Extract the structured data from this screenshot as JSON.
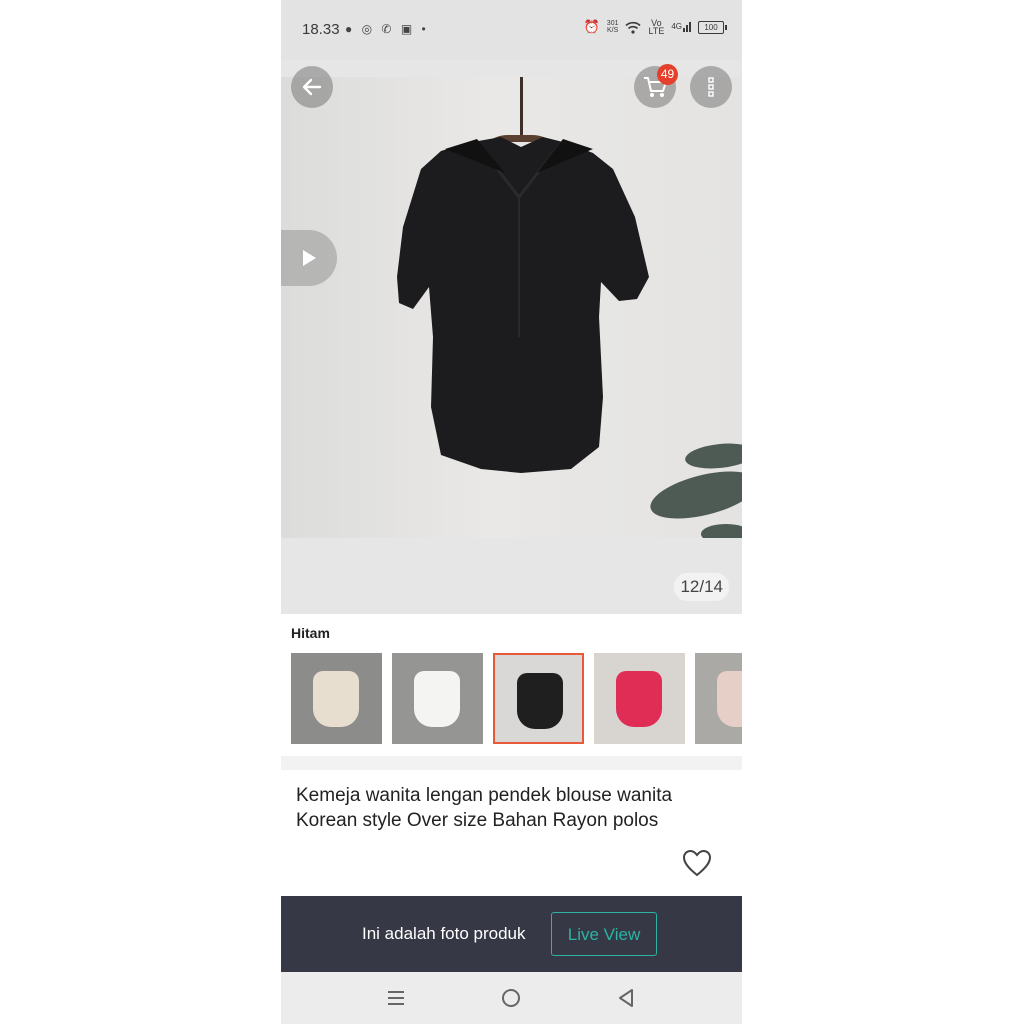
{
  "status_bar": {
    "time": "18.33",
    "left_icons": [
      "chat-icon",
      "whatsapp-icon",
      "call-icon",
      "instagram-icon",
      "dot-icon"
    ],
    "net_speed_top": "301",
    "net_speed_bottom": "K/S",
    "volte_top": "Vo",
    "volte_bottom": "LTE",
    "network": "4G",
    "battery": "100"
  },
  "header": {
    "back_icon": "arrow-left-icon",
    "cart_icon": "cart-icon",
    "cart_count": "49",
    "more_icon": "more-vertical-icon"
  },
  "gallery": {
    "counter": "12/14",
    "play_icon": "play-icon"
  },
  "variants": {
    "selected_label": "Hitam",
    "items": [
      {
        "color": "#e8ded0"
      },
      {
        "color": "#f4f4f2"
      },
      {
        "color": "#1f1f1f"
      },
      {
        "color": "#e02d55"
      },
      {
        "color": "#e6cfc7"
      }
    ],
    "selected_index": 2
  },
  "product": {
    "title": "Kemeja wanita lengan pendek blouse wanita Korean style Over size Bahan Rayon polos"
  },
  "banner": {
    "text": "Ini adalah foto produk",
    "button_label": "Live View",
    "accent_color": "#2bb3a4"
  },
  "navbar": {
    "items": [
      "menu-icon",
      "home-icon",
      "back-icon"
    ]
  }
}
